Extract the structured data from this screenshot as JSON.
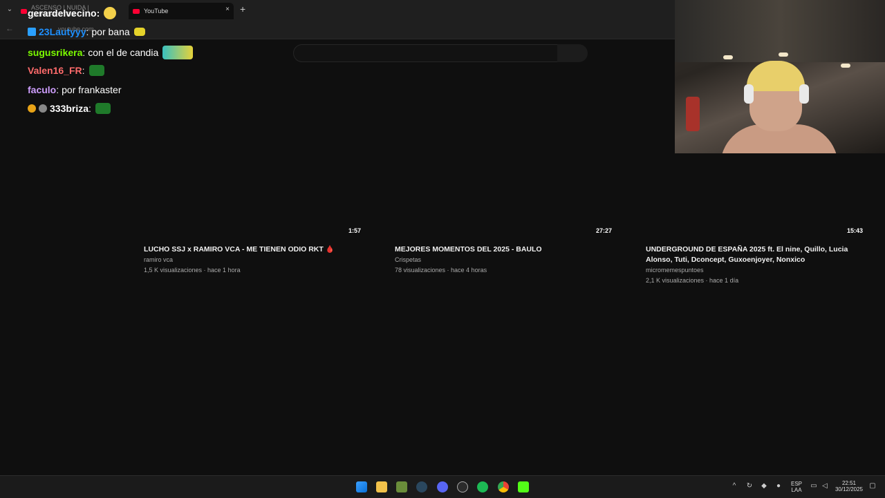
{
  "browser": {
    "tabs": [
      {
        "label": "ASCENSO | NUIDA | CONCRECTOS",
        "active": false
      },
      {
        "label": "YouTube",
        "active": true
      }
    ],
    "new_tab_label": "+",
    "close_label": "×",
    "url": "youtube.com"
  },
  "chat": [
    {
      "user": "gerardelvecino",
      "color": "#ffffff",
      "message": ""
    },
    {
      "user": "23Lautyyy",
      "color": "#1e90ff",
      "message": "por bana"
    },
    {
      "user": "sugusrikera",
      "color": "#7cfc00",
      "message": "con el de candia"
    },
    {
      "user": "Valen16_FR",
      "color": "#ff6b6b",
      "message": ""
    },
    {
      "user": "faculo",
      "color": "#cf9fff",
      "message": "por frankaster"
    },
    {
      "user": "333briza",
      "color": "#ffffff",
      "message": ""
    }
  ],
  "videos": [
    {
      "duration": "1:57",
      "title": "LUCHO SSJ x RAMIRO VCA - ME TIENEN ODIO RKT 🩸",
      "channel": "ramiro vca",
      "meta": "1,5 K visualizaciones · hace 1 hora"
    },
    {
      "duration": "27:27",
      "title": "MEJORES MOMENTOS DEL 2025 - BAULO",
      "channel": "Crispetas",
      "meta": "78 visualizaciones · hace 4 horas"
    },
    {
      "duration": "15:43",
      "title": "UNDERGROUND DE ESPAÑA 2025 ft. El nine, Quillo, Lucia Alonso, Tuti, Dconcept, Guxoenjoyer, Nonxico",
      "channel": "micromemespuntoes",
      "meta": "2,1 K visualizaciones · hace 1 día"
    }
  ],
  "taskbar": {
    "icons": [
      "windows-icon",
      "file-explorer-icon",
      "minecraft-icon",
      "steam-icon",
      "discord-icon",
      "obs-icon",
      "spotify-icon",
      "chrome-icon",
      "kick-icon"
    ],
    "language": "ESP",
    "region": "LAA",
    "time": "22:51",
    "date": "30/12/2025"
  }
}
